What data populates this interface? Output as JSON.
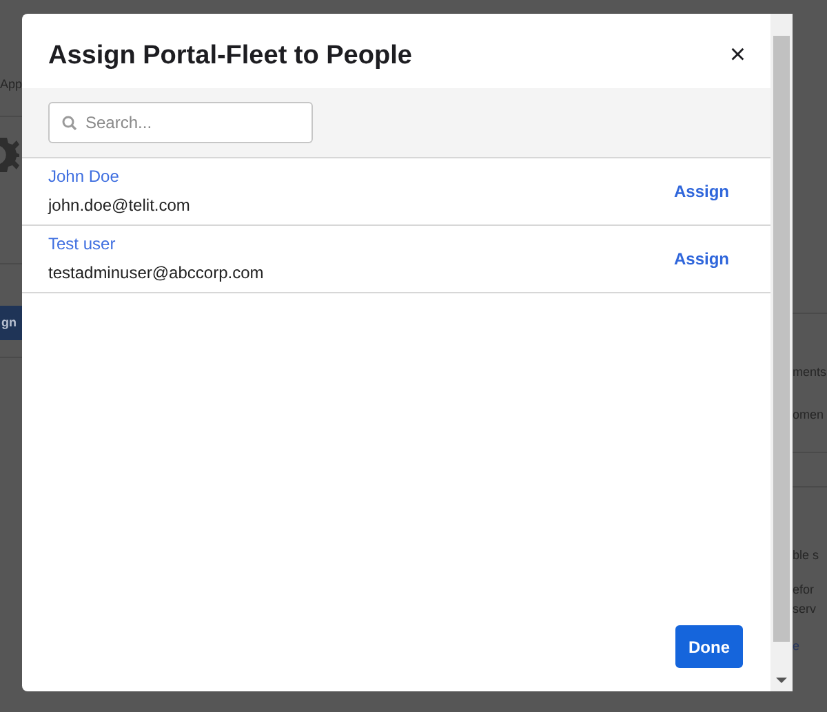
{
  "background": {
    "left_text": "App",
    "left_button": "gn",
    "right_texts": [
      {
        "text": "ments",
        "kind": "text"
      },
      {
        "text": "omen",
        "kind": "text"
      },
      {
        "text": "ble s",
        "kind": "text"
      },
      {
        "text": "efor",
        "kind": "text"
      },
      {
        "text": "serv",
        "kind": "text"
      },
      {
        "text": "e",
        "kind": "link"
      }
    ]
  },
  "dialog": {
    "title": "Assign Portal-Fleet to People",
    "close": "×",
    "search": {
      "placeholder": "Search..."
    },
    "people": [
      {
        "name": "John Doe",
        "email": "john.doe@telit.com",
        "action": "Assign"
      },
      {
        "name": "Test user",
        "email": "testadminuser@abccorp.com",
        "action": "Assign"
      }
    ],
    "done": "Done"
  }
}
